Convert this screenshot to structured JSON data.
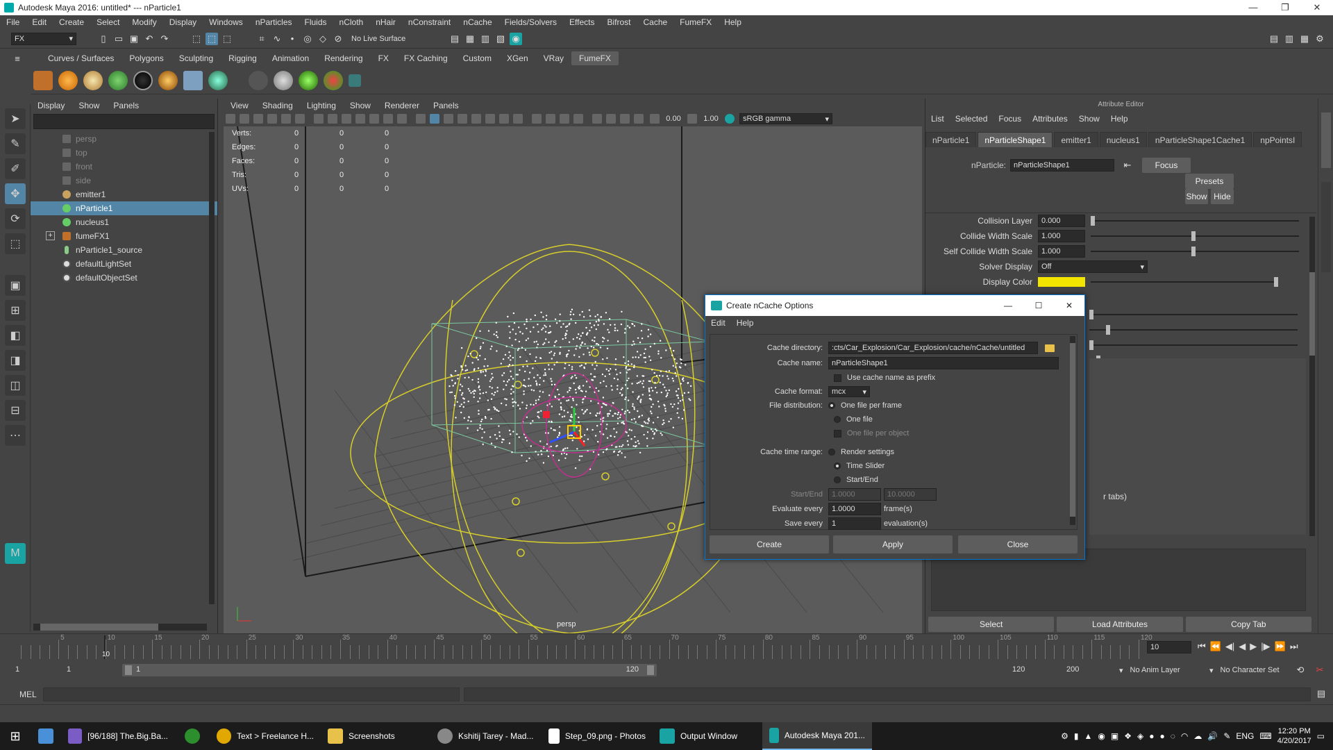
{
  "titlebar": {
    "title": "Autodesk Maya 2016: untitled*   ---   nParticle1",
    "minimize": "—",
    "maximize": "❐",
    "close": "✕"
  },
  "menubar": [
    "File",
    "Edit",
    "Create",
    "Select",
    "Modify",
    "Display",
    "Windows",
    "nParticles",
    "Fluids",
    "nCloth",
    "nHair",
    "nConstraint",
    "nCache",
    "Fields/Solvers",
    "Effects",
    "Bifrost",
    "Cache",
    "FumeFX",
    "Help"
  ],
  "statusline": {
    "menuset": "FX",
    "live_surface": "No Live Surface"
  },
  "shelf_tabs": [
    "Curves / Surfaces",
    "Polygons",
    "Sculpting",
    "Rigging",
    "Animation",
    "Rendering",
    "FX",
    "FX Caching",
    "Custom",
    "XGen",
    "VRay",
    "FumeFX"
  ],
  "active_shelf": "FumeFX",
  "outliner": {
    "menu": [
      "Display",
      "Show",
      "Panels"
    ],
    "items": [
      {
        "label": "persp",
        "dim": true
      },
      {
        "label": "top",
        "dim": true
      },
      {
        "label": "front",
        "dim": true
      },
      {
        "label": "side",
        "dim": true
      },
      {
        "label": "emitter1",
        "dim": false
      },
      {
        "label": "nParticle1",
        "dim": false,
        "selected": true
      },
      {
        "label": "nucleus1",
        "dim": false
      },
      {
        "label": "fumeFX1",
        "dim": false
      },
      {
        "label": "nParticle1_source",
        "dim": false
      },
      {
        "label": "defaultLightSet",
        "dim": false
      },
      {
        "label": "defaultObjectSet",
        "dim": false
      }
    ]
  },
  "viewport": {
    "menu": [
      "View",
      "Shading",
      "Lighting",
      "Show",
      "Renderer",
      "Panels"
    ],
    "exposure": "0.00",
    "gamma": "1.00",
    "color_space": "sRGB gamma",
    "camera_label": "persp",
    "hud": {
      "rows": [
        {
          "label": "Verts:",
          "a": "0",
          "b": "0",
          "c": "0"
        },
        {
          "label": "Edges:",
          "a": "0",
          "b": "0",
          "c": "0"
        },
        {
          "label": "Faces:",
          "a": "0",
          "b": "0",
          "c": "0"
        },
        {
          "label": "Tris:",
          "a": "0",
          "b": "0",
          "c": "0"
        },
        {
          "label": "UVs:",
          "a": "0",
          "b": "0",
          "c": "0"
        }
      ]
    }
  },
  "attribute_editor": {
    "header": "Attribute Editor",
    "menu": [
      "List",
      "Selected",
      "Focus",
      "Attributes",
      "Show",
      "Help"
    ],
    "tabs": [
      "nParticle1",
      "nParticleShape1",
      "emitter1",
      "nucleus1",
      "nParticleShape1Cache1",
      "npPointsI"
    ],
    "active_tab": "nParticleShape1",
    "node_label": "nParticle:",
    "node_value": "nParticleShape1",
    "focus_btn": "Focus",
    "presets_btn": "Presets",
    "show_btn": "Show",
    "hide_btn": "Hide",
    "attrs": [
      {
        "label": "Collision Layer",
        "value": "0.000",
        "slider": 0.0
      },
      {
        "label": "Collide Width Scale",
        "value": "1.000",
        "slider": 0.4
      },
      {
        "label": "Self Collide Width Scale",
        "value": "1.000",
        "slider": 0.4
      }
    ],
    "solver_display_label": "Solver Display",
    "solver_display_value": "Off",
    "display_color_label": "Display Color",
    "display_color": "#f2e600",
    "partial_text": "r tabs)",
    "select_btn": "Select",
    "load_btn": "Load Attributes",
    "copy_btn": "Copy Tab"
  },
  "dialog": {
    "title": "Create nCache Options",
    "menu": [
      "Edit",
      "Help"
    ],
    "cache_directory_label": "Cache directory:",
    "cache_directory": ":cts/Car_Explosion/Car_Explosion/cache/nCache/untitled",
    "cache_name_label": "Cache name:",
    "cache_name": "nParticleShape1",
    "use_prefix": "Use cache name as prefix",
    "cache_format_label": "Cache format:",
    "cache_format": "mcx",
    "file_distribution_label": "File distribution:",
    "dist_options": [
      "One file per frame",
      "One file",
      "One file per object"
    ],
    "cache_time_range_label": "Cache time range:",
    "range_options": [
      "Render settings",
      "Time Slider",
      "Start/End"
    ],
    "start_end_label": "Start/End",
    "start_value": "1.0000",
    "end_value": "10.0000",
    "evaluate_label": "Evaluate every",
    "evaluate_value": "1.0000",
    "evaluate_unit": "frame(s)",
    "save_label": "Save every",
    "save_value": "1",
    "save_unit": "evaluation(s)",
    "create_btn": "Create",
    "apply_btn": "Apply",
    "close_btn": "Close"
  },
  "timeline": {
    "ticks": [
      "5",
      "10",
      "15",
      "20",
      "25",
      "30",
      "35",
      "40",
      "45",
      "50",
      "55",
      "60",
      "65",
      "70",
      "75",
      "80",
      "85",
      "90",
      "95",
      "100",
      "105",
      "110",
      "115",
      "120"
    ],
    "current_frame": "10",
    "current_field": "10",
    "range_start": "1",
    "range_start2": "1",
    "range_inner_start": "1",
    "range_inner_end": "120",
    "range_end": "120",
    "range_end2": "200",
    "anim_layer": "No Anim Layer",
    "char_set": "No Character Set"
  },
  "cmdline": {
    "label": "MEL"
  },
  "taskbar": {
    "items": [
      {
        "label": "[96/188] The.Big.Ba...",
        "color": "#7a5cc4",
        "active": false
      },
      {
        "label": "",
        "color": "#2d8e2d",
        "active": false
      },
      {
        "label": "Text > Freelance H...",
        "color": "#e0a800",
        "active": false
      },
      {
        "label": "Screenshots",
        "color": "#e8c14a",
        "active": false
      },
      {
        "label": "Kshitij Tarey - Mad...",
        "color": "#888888",
        "active": false
      },
      {
        "label": "Step_09.png - Photos",
        "color": "#ffffff",
        "active": false
      },
      {
        "label": "Output Window",
        "color": "#1aa3a3",
        "active": false
      },
      {
        "label": "Autodesk Maya 201...",
        "color": "#1aa3a3",
        "active": true
      }
    ],
    "lang": "ENG",
    "time": "12:20 PM",
    "date": "4/20/2017"
  }
}
